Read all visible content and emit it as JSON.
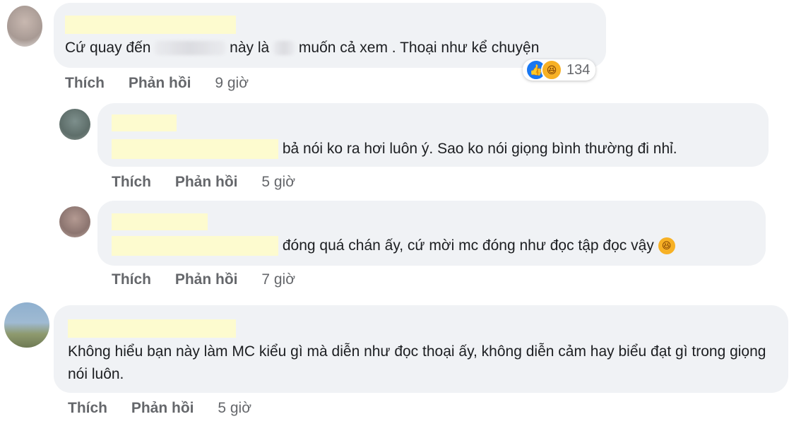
{
  "comments": [
    {
      "text_pre": "Cứ quay đến",
      "text_mid": "này là",
      "text_post": "muốn cả xem . Thoại như kể chuyện",
      "like": "Thích",
      "reply": "Phản hồi",
      "time": "9 giờ",
      "reaction_count": "134"
    },
    {
      "text": "bả nói ko ra hơi luôn ý. Sao ko nói giọng bình thường đi nhỉ.",
      "like": "Thích",
      "reply": "Phản hồi",
      "time": "5 giờ"
    },
    {
      "text": "đóng quá chán ấy, cứ mời mc đóng như đọc tập đọc vậy",
      "like": "Thích",
      "reply": "Phản hồi",
      "time": "7 giờ"
    },
    {
      "text": "Không hiểu bạn này làm MC kiểu gì mà diễn như đọc thoại ấy, không diễn cảm hay biểu đạt gì trong giọng nói luôn.",
      "like": "Thích",
      "reply": "Phản hồi",
      "time": "5 giờ"
    }
  ],
  "icons": {
    "reaction_like": "like-icon",
    "reaction_haha": "haha-icon",
    "inline_emoji": "rofl-emoji-icon"
  },
  "colors": {
    "bubble": "#f0f2f5",
    "name_redaction": "#fdfbcf",
    "action_text": "#65676b",
    "like_blue": "#1877f2"
  }
}
